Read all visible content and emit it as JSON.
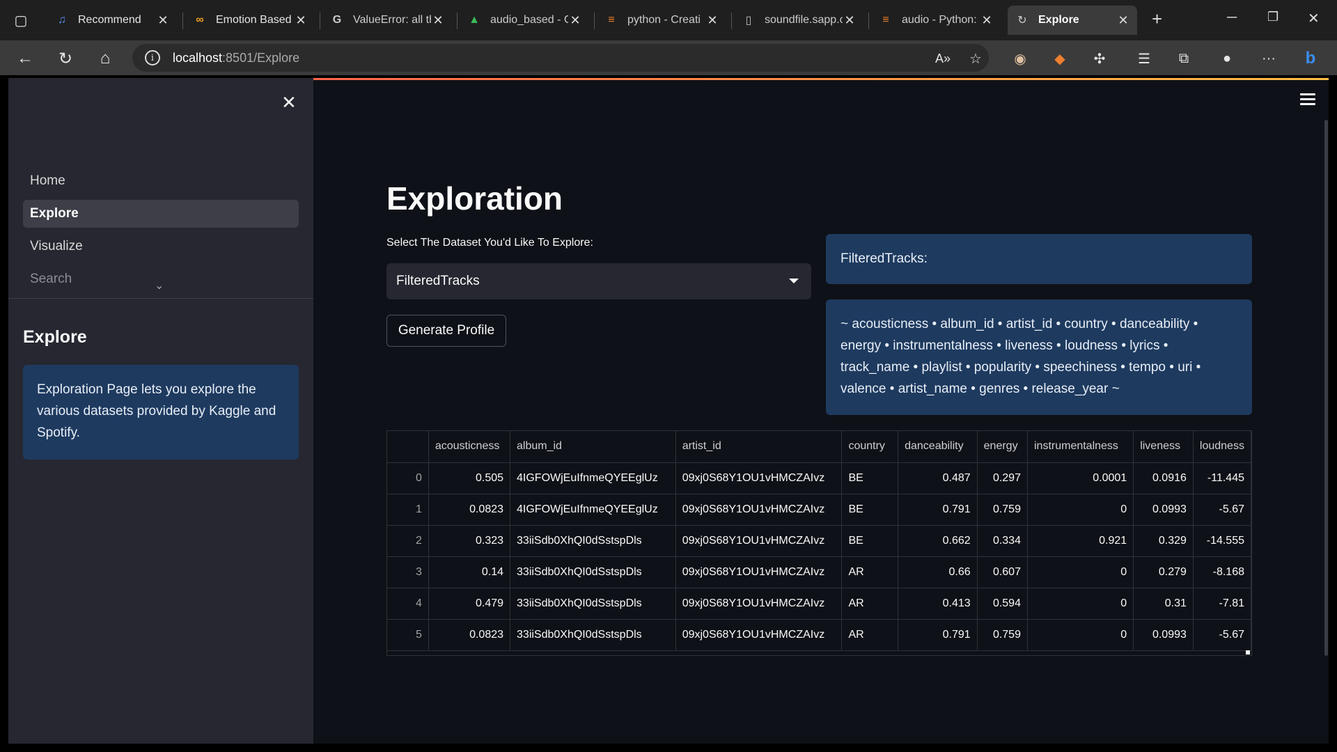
{
  "browser": {
    "tabs": [
      {
        "label": "Recommend",
        "icon": "music-note-icon"
      },
      {
        "label": "Emotion Based l",
        "icon": "infinity-icon"
      },
      {
        "label": "ValueError: all th",
        "icon": "google-icon"
      },
      {
        "label": "audio_based - G",
        "icon": "drive-icon"
      },
      {
        "label": "python - Creati",
        "icon": "stackoverflow-icon"
      },
      {
        "label": "soundfile.sapp.c",
        "icon": "doc-icon"
      },
      {
        "label": "audio - Python:",
        "icon": "stackoverflow-icon"
      },
      {
        "label": "Explore",
        "icon": "streamlit-icon"
      }
    ],
    "url_host": "localhost",
    "url_path": ":8501/Explore"
  },
  "sidebar": {
    "nav": [
      "Home",
      "Explore",
      "Visualize",
      "Search"
    ],
    "header": "Explore",
    "info": "Exploration Page lets you explore the various datasets provided by Kaggle and Spotify."
  },
  "main": {
    "title": "Exploration",
    "select_label": "Select The Dataset You'd Like To Explore:",
    "select_value": "FilteredTracks",
    "button_label": "Generate Profile",
    "info_title": "FilteredTracks:",
    "columns_text": "~ acousticness • album_id • artist_id • country • danceability • energy • instrumentalness • liveness • loudness • lyrics • track_name • playlist • popularity • speechiness • tempo • uri • valence • artist_name • genres • release_year ~"
  },
  "table": {
    "headers": [
      "",
      "acousticness",
      "album_id",
      "artist_id",
      "country",
      "danceability",
      "energy",
      "instrumentalness",
      "liveness",
      "loudness"
    ],
    "rows": [
      [
        "0",
        "0.505",
        "4IGFOWjEuIfnmeQYEEglUz",
        "09xj0S68Y1OU1vHMCZAIvz",
        "BE",
        "0.487",
        "0.297",
        "0.0001",
        "0.0916",
        "-11.445"
      ],
      [
        "1",
        "0.0823",
        "4IGFOWjEuIfnmeQYEEglUz",
        "09xj0S68Y1OU1vHMCZAIvz",
        "BE",
        "0.791",
        "0.759",
        "0",
        "0.0993",
        "-5.67"
      ],
      [
        "2",
        "0.323",
        "33iiSdb0XhQI0dSstspDls",
        "09xj0S68Y1OU1vHMCZAIvz",
        "BE",
        "0.662",
        "0.334",
        "0.921",
        "0.329",
        "-14.555"
      ],
      [
        "3",
        "0.14",
        "33iiSdb0XhQI0dSstspDls",
        "09xj0S68Y1OU1vHMCZAIvz",
        "AR",
        "0.66",
        "0.607",
        "0",
        "0.279",
        "-8.168"
      ],
      [
        "4",
        "0.479",
        "33iiSdb0XhQI0dSstspDls",
        "09xj0S68Y1OU1vHMCZAIvz",
        "AR",
        "0.413",
        "0.594",
        "0",
        "0.31",
        "-7.81"
      ],
      [
        "5",
        "0.0823",
        "33iiSdb0XhQI0dSstspDls",
        "09xj0S68Y1OU1vHMCZAIvz",
        "AR",
        "0.791",
        "0.759",
        "0",
        "0.0993",
        "-5.67"
      ]
    ]
  }
}
